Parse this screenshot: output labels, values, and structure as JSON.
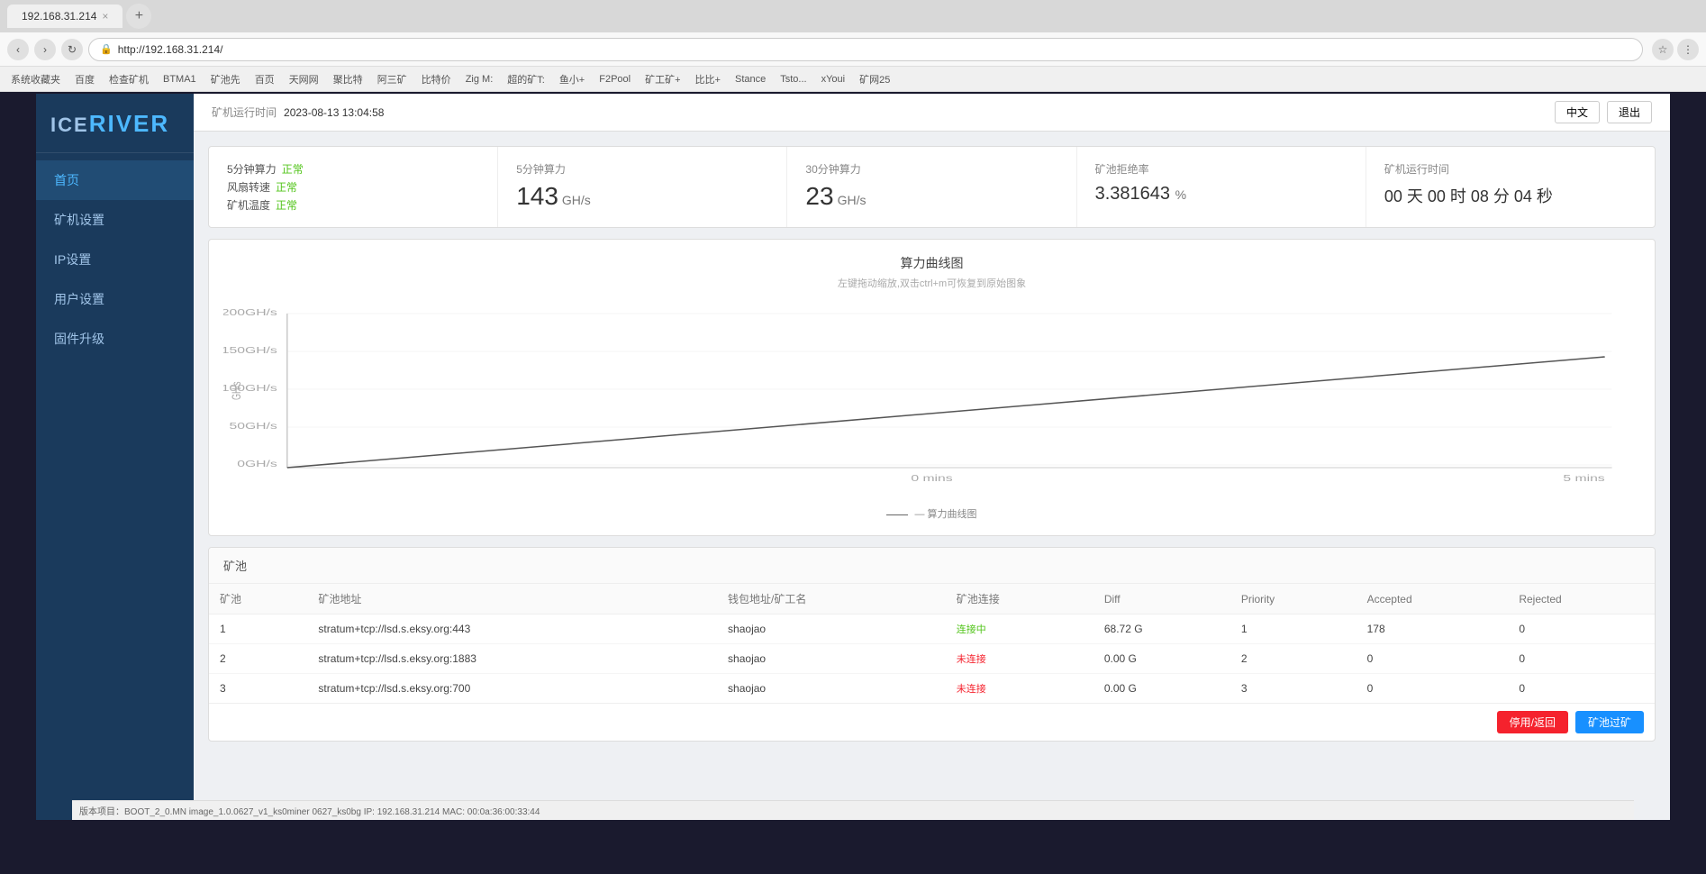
{
  "browser": {
    "address": "http://192.168.31.214/",
    "tab_label": "192.168.31.214",
    "bookmarks": [
      "系统收藏夹",
      "百度",
      "检查矿机",
      "BTMA1",
      "矿池先",
      "百页",
      "天网网",
      "聚比特",
      "阿三矿",
      "比特价",
      "Zig M:",
      "超的矿T:",
      "鱼小+",
      "F2Pool",
      "矿工矿+",
      "比比+",
      "Stance",
      "Tsto...",
      "xYoui",
      "矿网25"
    ]
  },
  "header": {
    "run_time_label": "矿机运行时间",
    "datetime": "2023-08-13 13:04:58",
    "btn1": "中文",
    "btn2": "退出"
  },
  "logo": {
    "prefix": "ICE",
    "name": "RIVER"
  },
  "nav": {
    "items": [
      {
        "label": "首页",
        "active": true
      },
      {
        "label": "矿机设置",
        "active": false
      },
      {
        "label": "IP设置",
        "active": false
      },
      {
        "label": "用户设置",
        "active": false
      },
      {
        "label": "固件升级",
        "active": false
      }
    ]
  },
  "stats": {
    "card1": {
      "title": "5分钟算力",
      "status_rows": [
        {
          "label": "5分钟算力",
          "value": "正常",
          "ok": true
        },
        {
          "label": "风扇转速",
          "value": "正常",
          "ok": true
        },
        {
          "label": "矿机温度",
          "value": "正常",
          "ok": true
        }
      ]
    },
    "card2": {
      "title": "5分钟算力",
      "value": "143",
      "unit": "GH/s"
    },
    "card3": {
      "title": "30分钟算力",
      "value": "23",
      "unit": "GH/s"
    },
    "card4": {
      "title": "矿池拒绝率",
      "value": "3.381643",
      "unit": "%"
    },
    "card5": {
      "title": "矿机运行时间",
      "value": "00 天 00 时 08 分 04 秒"
    }
  },
  "chart": {
    "title": "算力曲线图",
    "subtitle": "左键拖动缩放,双击ctrl+m可恢复到原始图象",
    "y_labels": [
      "200GH/s",
      "150GH/s",
      "100GH/s",
      "50GH/s",
      "0GH/s"
    ],
    "x_labels": [
      "0 mins",
      "5 mins"
    ],
    "legend": "— 算力曲线图"
  },
  "pool": {
    "section_title": "矿池",
    "columns": [
      "矿池",
      "矿池地址",
      "钱包地址/矿工名",
      "矿池连接",
      "Diff",
      "Priority",
      "Accepted",
      "Rejected"
    ],
    "rows": [
      {
        "id": "1",
        "address": "stratum+tcp://lsd.s.eksy.org:443",
        "wallet": "shaojao",
        "connection": "连接中",
        "connection_type": "active",
        "diff": "68.72 G",
        "priority": "1",
        "accepted": "178",
        "rejected": "0"
      },
      {
        "id": "2",
        "address": "stratum+tcp://lsd.s.eksy.org:1883",
        "wallet": "shaojao",
        "connection": "未连接",
        "connection_type": "disconnected",
        "diff": "0.00 G",
        "priority": "2",
        "accepted": "0",
        "rejected": "0"
      },
      {
        "id": "3",
        "address": "stratum+tcp://lsd.s.eksy.org:700",
        "wallet": "shaojao",
        "connection": "未连接",
        "connection_type": "disconnected",
        "diff": "0.00 G",
        "priority": "3",
        "accepted": "0",
        "rejected": "0"
      }
    ],
    "btn_delete": "停用/返回",
    "btn_save": "矿池过矿"
  },
  "footer": {
    "text": "版本项目：BOOT_2_0.MN image_1.0.0627_v1_ks0miner 0627_ks0bg   IP: 192.168.31.214   MAC: 00:0a:36:00:33:44"
  }
}
